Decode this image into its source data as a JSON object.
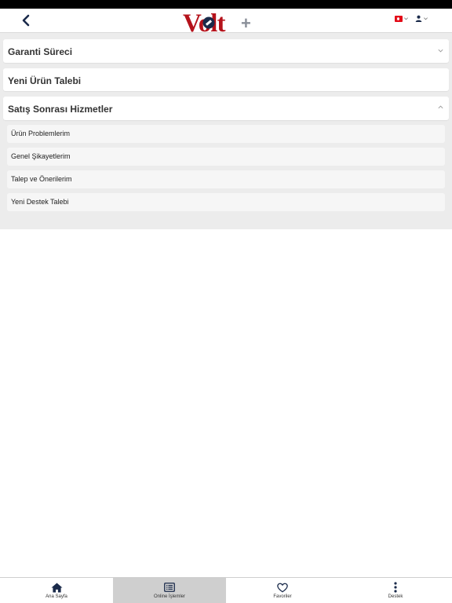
{
  "header": {
    "logo_text": "Volt",
    "logo_plus": "+"
  },
  "sections": [
    {
      "title": "Garanti Süreci"
    },
    {
      "title": "Yeni Ürün Talebi"
    },
    {
      "title": "Satış Sonrası Hizmetler"
    }
  ],
  "sub_items": [
    {
      "label": "Ürün Problemlerim"
    },
    {
      "label": "Genel Şikayetlerim"
    },
    {
      "label": "Talep ve Önerilerim"
    },
    {
      "label": "Yeni Destek Talebi"
    }
  ],
  "bottom_nav": [
    {
      "label": "Ana Sayfa",
      "icon": "home-icon"
    },
    {
      "label": "Online İşlemler",
      "icon": "list-icon"
    },
    {
      "label": "Favoriler",
      "icon": "heart-icon"
    },
    {
      "label": "Destek",
      "icon": "more-vertical-icon"
    }
  ],
  "colors": {
    "brand_red": "#b5121b",
    "brand_navy": "#1a2a4a",
    "active_tab": "#cfcfcf",
    "content_bg": "#ececec"
  }
}
